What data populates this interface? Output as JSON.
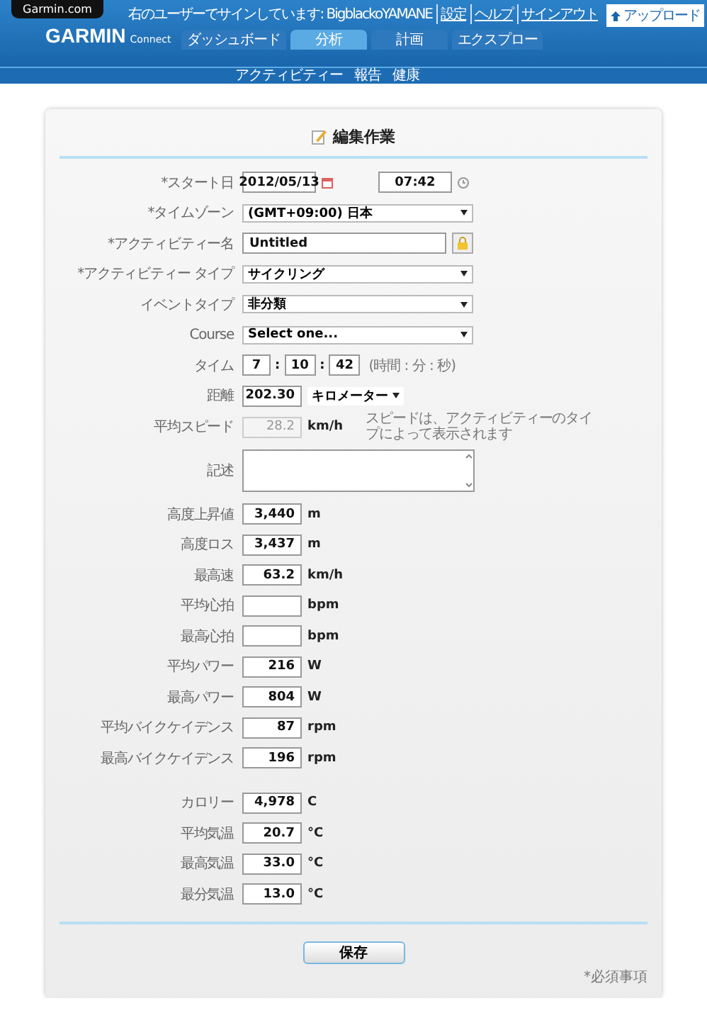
{
  "header": {
    "site_tab": "Garmin.com",
    "logo": {
      "brand": "GARMIN",
      "sub": "Connect"
    },
    "user_text": "右のユーザーでサインしています: BigblackoYAMANE",
    "links": [
      "設定",
      "ヘルプ",
      "サインアウト"
    ],
    "upload_button": "アップロード",
    "nav_tabs": [
      {
        "label": "ダッシュボード",
        "selected": false
      },
      {
        "label": "分析",
        "selected": true
      },
      {
        "label": "計画",
        "selected": false
      },
      {
        "label": "エクスプロー",
        "selected": false
      }
    ],
    "subnav": [
      "アクティビティー",
      "報告",
      "健康"
    ]
  },
  "form": {
    "title": "編集作業",
    "sections": [
      [
        {
          "kind": "datetime",
          "label": "*スタート日",
          "date": "2012/05/13",
          "time": "07:42"
        },
        {
          "kind": "select",
          "label": "*タイムゾーン",
          "value": "(GMT+09:00) 日本"
        },
        {
          "kind": "text",
          "label": "*アクティビティー名",
          "value": "Untitled"
        },
        {
          "kind": "select",
          "label": "*アクティビティー タイプ",
          "value": "サイクリング"
        },
        {
          "kind": "select",
          "label": "イベントタイプ",
          "value": "非分類"
        },
        {
          "kind": "select",
          "label": "Course",
          "value": "Select one..."
        },
        {
          "kind": "time",
          "label": "タイム",
          "hours": "7",
          "minutes": "10",
          "seconds": "42",
          "separator": ":",
          "hint": "(時間 : 分 : 秒)"
        },
        {
          "kind": "distance",
          "label": "距離",
          "value": "202.30",
          "unit": "キロメーター"
        },
        {
          "kind": "number",
          "label": "平均スピード",
          "value": "28.2",
          "unit": "km/h",
          "disabled": true,
          "note": "スピードは、アクティビティーのタイプによって表示されます"
        },
        {
          "kind": "textarea",
          "label": "記述"
        },
        {
          "kind": "number",
          "label": "高度上昇値",
          "value": "3,440",
          "unit": "m",
          "disabled": false
        },
        {
          "kind": "number",
          "label": "高度ロス",
          "value": "3,437",
          "unit": "m",
          "disabled": false
        },
        {
          "kind": "number",
          "label": "最高速",
          "value": "63.2",
          "unit": "km/h",
          "disabled": false
        },
        {
          "kind": "number",
          "label": "平均心拍",
          "unit": "bpm",
          "disabled": false
        },
        {
          "kind": "number",
          "label": "最高心拍",
          "unit": "bpm",
          "disabled": false
        },
        {
          "kind": "number",
          "label": "平均パワー",
          "value": "216",
          "unit": "W",
          "disabled": false
        },
        {
          "kind": "number",
          "label": "最高パワー",
          "value": "804",
          "unit": "W",
          "disabled": false
        },
        {
          "kind": "number",
          "label": "平均バイクケイデンス",
          "value": "87",
          "unit": "rpm",
          "disabled": false
        },
        {
          "kind": "number",
          "label": "最高バイクケイデンス",
          "value": "196",
          "unit": "rpm",
          "disabled": false
        }
      ],
      [
        {
          "kind": "number",
          "label": "カロリー",
          "value": "4,978",
          "unit": "C",
          "disabled": false
        },
        {
          "kind": "number",
          "label": "平均気温",
          "value": "20.7",
          "unit": "°C",
          "disabled": false
        },
        {
          "kind": "number",
          "label": "最高気温",
          "value": "33.0",
          "unit": "°C",
          "disabled": false
        },
        {
          "kind": "number",
          "label": "最分気温",
          "value": "13.0",
          "unit": "°C",
          "disabled": false
        }
      ]
    ],
    "save_button": "保存",
    "footnote": "*必須事項"
  }
}
